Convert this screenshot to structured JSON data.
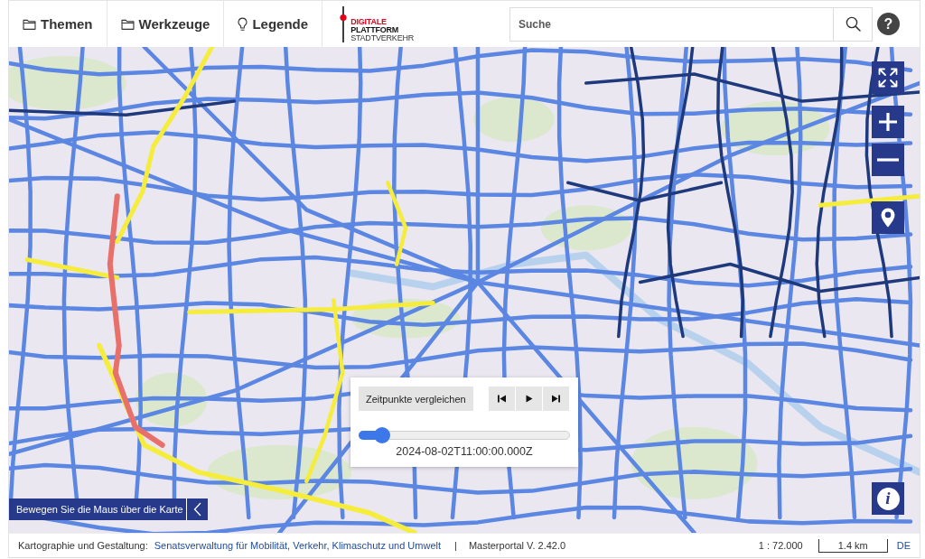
{
  "menu": [
    {
      "label": "Themen",
      "kind": "folder"
    },
    {
      "label": "Werkzeuge",
      "kind": "folder"
    },
    {
      "label": "Legende",
      "kind": "lightbulb"
    }
  ],
  "logo": {
    "lines": [
      "DIGITALE",
      "PLATTFORM",
      "STADTVERKEHR"
    ]
  },
  "search": {
    "placeholder": "Suche"
  },
  "help": {
    "label": "?"
  },
  "info": {
    "label": "i"
  },
  "time_slider": {
    "compare_button": "Zeitpunkte vergleichen",
    "level": 0.11,
    "timestamp": "2024-08-02T11:00:00.000Z"
  },
  "mouse_position": {
    "text": "Bewegen Sie die Maus über die Karte"
  },
  "footer": {
    "credit_label": "Kartographie und Gestaltung:",
    "credit_link": "Senatsverwaltung für Mobilität, Verkehr, Klimaschutz und Umwelt",
    "separator": "|",
    "version": "Masterportal V. 2.42.0",
    "scale": "1 : 72.000",
    "scale_bar": "1.4 km",
    "language": "DE"
  }
}
